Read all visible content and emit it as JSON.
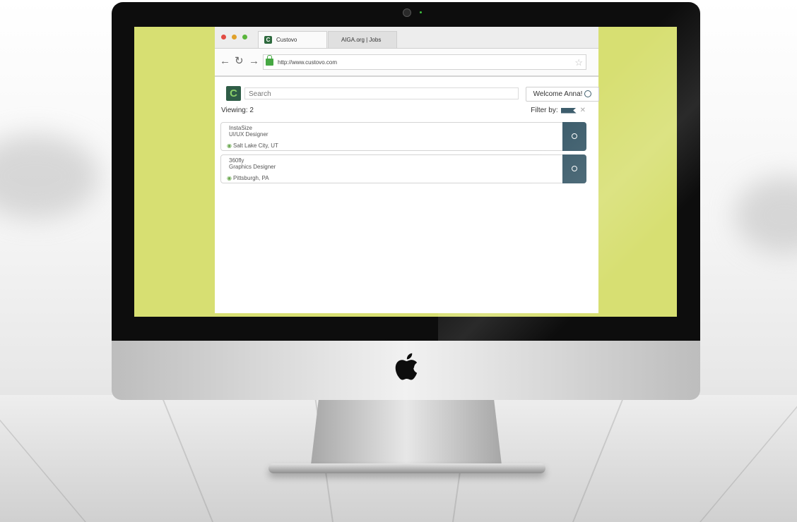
{
  "browser": {
    "tabs": [
      {
        "label": "Custovo",
        "active": true
      },
      {
        "label": "AIGA.org | Jobs",
        "active": false
      }
    ],
    "url": "http://www.custovo.com",
    "traffic_light_colors": [
      "#e24b43",
      "#e0a12a",
      "#5ab53c"
    ]
  },
  "app": {
    "logo_glyph": "C",
    "search_placeholder": "Search",
    "welcome_label": "Welcome Anna!",
    "viewing_label": "Viewing: 2",
    "filter_label": "Filter by:",
    "accent_color": "#3d5d6c",
    "jobs": [
      {
        "company": "InstaSize",
        "title": "UI/UX Designer",
        "location": "Salt Lake City, UT"
      },
      {
        "company": "360fly",
        "title": "Graphics Designer",
        "location": "Pittsburgh, PA"
      }
    ]
  },
  "colors": {
    "desktop_wallpaper": "#d7df72"
  }
}
